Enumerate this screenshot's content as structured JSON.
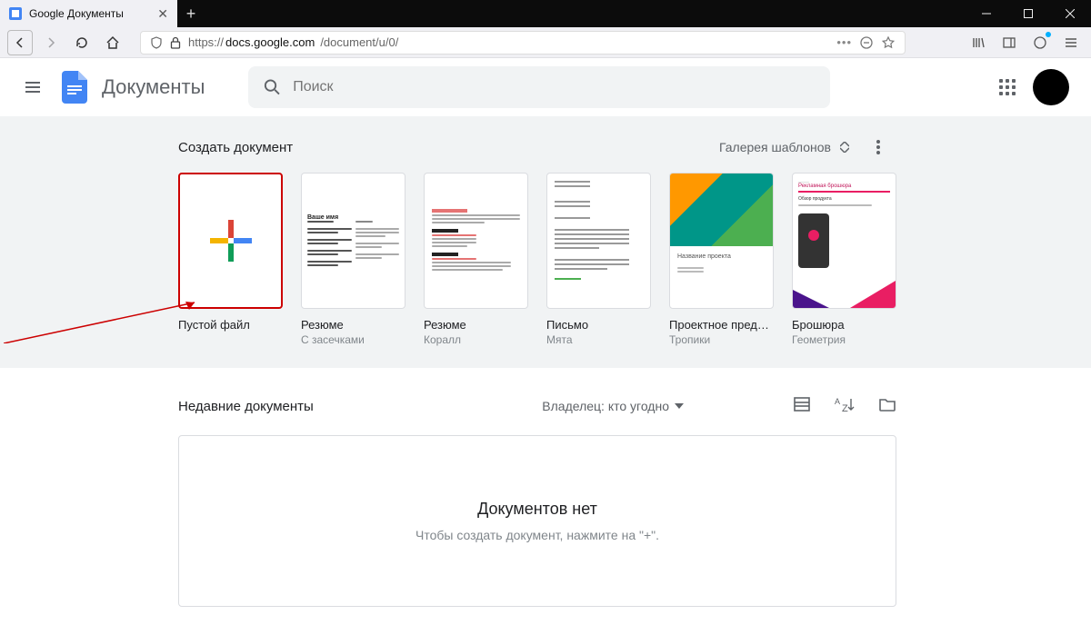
{
  "browser": {
    "tab_title": "Google Документы",
    "url_prefix": "https://",
    "url_domain": "docs.google.com",
    "url_path": "/document/u/0/"
  },
  "header": {
    "product_name": "Документы",
    "search_placeholder": "Поиск"
  },
  "templates": {
    "title": "Создать документ",
    "gallery_label": "Галерея шаблонов",
    "items": [
      {
        "label": "Пустой файл",
        "sub": ""
      },
      {
        "label": "Резюме",
        "sub": "С засечками"
      },
      {
        "label": "Резюме",
        "sub": "Коралл"
      },
      {
        "label": "Письмо",
        "sub": "Мята"
      },
      {
        "label": "Проектное пред…",
        "sub": "Тропики",
        "inner_caption": "Название проекта"
      },
      {
        "label": "Брошюра",
        "sub": "Геометрия",
        "inner_top": "Рекламная брошюра",
        "inner_mid": "Обзор продукта"
      }
    ],
    "resume1_heading": "Ваше имя"
  },
  "recent": {
    "title": "Недавние документы",
    "owner_filter": "Владелец: кто угодно",
    "empty_title": "Документов нет",
    "empty_sub": "Чтобы создать документ, нажмите на \"+\"."
  }
}
